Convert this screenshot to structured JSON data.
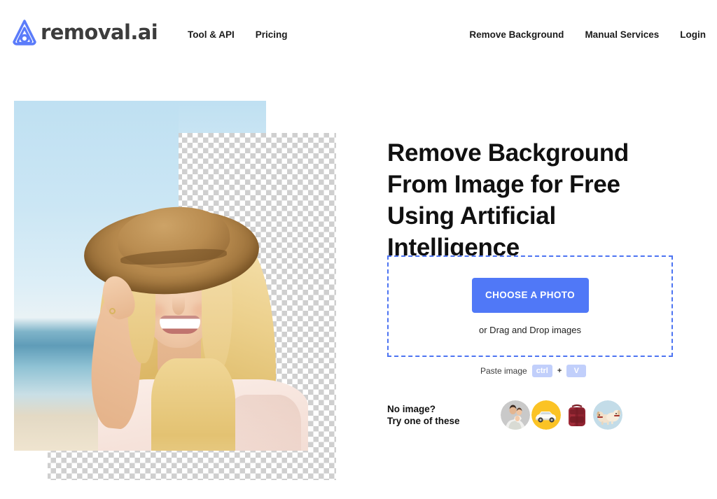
{
  "header": {
    "brand": {
      "name": "removal.ai",
      "logo_icon": "removal-ai-logo-icon",
      "color": "#5b7cfa"
    },
    "nav_left": [
      {
        "label": "Tool & API"
      },
      {
        "label": "Pricing"
      }
    ],
    "nav_right": [
      {
        "label": "Remove Background"
      },
      {
        "label": "Manual Services"
      },
      {
        "label": "Login"
      }
    ]
  },
  "hero": {
    "image": {
      "alt": "Smiling blonde woman wearing a straw hat at the beach, background partially removed showing transparency checkerboard",
      "transparency_pattern": "checkerboard",
      "checker_colors": [
        "#ffffff",
        "#cfcfcf"
      ]
    },
    "headline": "Remove Background From Image for Free Using Artificial Intelligence",
    "dropzone": {
      "button_label": "CHOOSE A PHOTO",
      "button_color": "#5078f7",
      "border_color": "#4d74f2",
      "drag_text": "or Drag and Drop images"
    },
    "paste": {
      "label": "Paste image",
      "key1": "ctrl",
      "separator": "+",
      "key2": "V",
      "key_bg": "#c1cffb"
    },
    "samples": {
      "line1": "No image?",
      "line2": "Try one of these",
      "thumbnails": [
        {
          "name": "sample-family",
          "subject": "family",
          "bg": "#c9c9c9"
        },
        {
          "name": "sample-car",
          "subject": "white car",
          "bg": "#fbc325"
        },
        {
          "name": "sample-backpack",
          "subject": "red backpack",
          "bg": "#ffffff"
        },
        {
          "name": "sample-dogs",
          "subject": "two puppies",
          "bg": "#c3dce8"
        }
      ]
    }
  }
}
